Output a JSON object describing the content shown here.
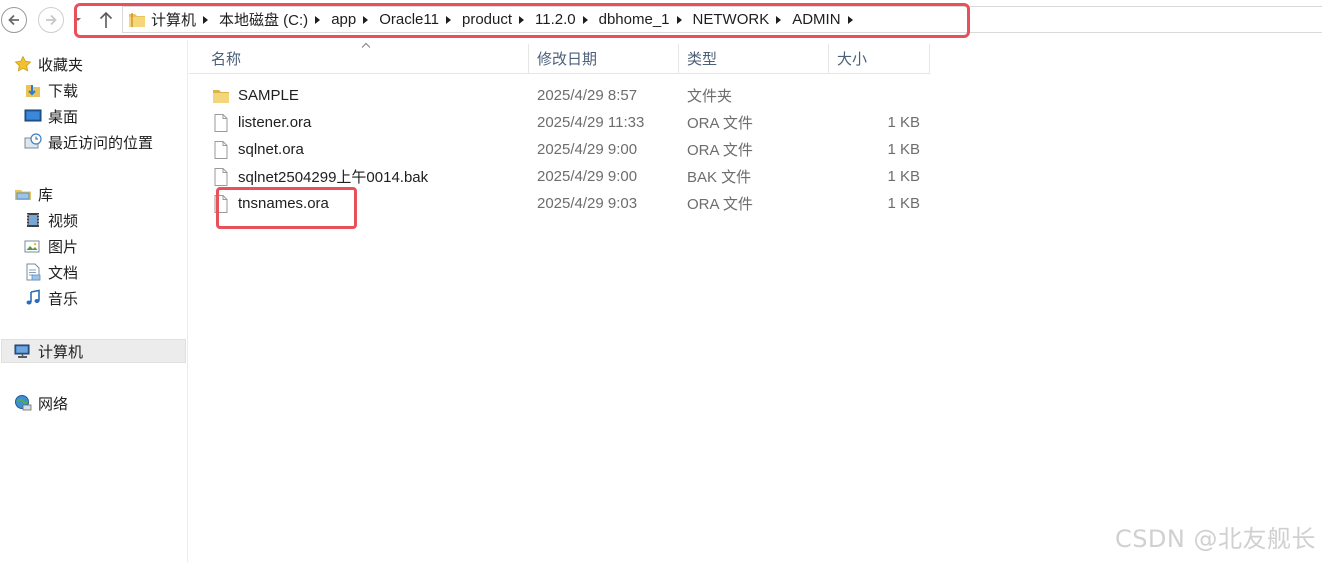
{
  "address_bar": {
    "breadcrumbs": [
      "计算机",
      "本地磁盘 (C:)",
      "app",
      "Oracle11",
      "product",
      "11.2.0",
      "dbhome_1",
      "NETWORK",
      "ADMIN"
    ]
  },
  "sidebar": {
    "favorites": {
      "label": "收藏夹",
      "items": [
        {
          "label": "下载",
          "icon": "download-folder-icon"
        },
        {
          "label": "桌面",
          "icon": "desktop-icon"
        },
        {
          "label": "最近访问的位置",
          "icon": "recent-places-icon"
        }
      ]
    },
    "libraries": {
      "label": "库",
      "items": [
        {
          "label": "视频",
          "icon": "video-library-icon"
        },
        {
          "label": "图片",
          "icon": "picture-library-icon"
        },
        {
          "label": "文档",
          "icon": "document-library-icon"
        },
        {
          "label": "音乐",
          "icon": "music-library-icon"
        }
      ]
    },
    "computer": {
      "label": "计算机"
    },
    "network": {
      "label": "网络"
    }
  },
  "file_list": {
    "columns": {
      "name": "名称",
      "date": "修改日期",
      "type": "类型",
      "size": "大小"
    },
    "rows": [
      {
        "name": "SAMPLE",
        "date": "2025/4/29 8:57",
        "type": "文件夹",
        "size": ""
      },
      {
        "name": "listener.ora",
        "date": "2025/4/29 11:33",
        "type": "ORA 文件",
        "size": "1 KB"
      },
      {
        "name": "sqlnet.ora",
        "date": "2025/4/29 9:00",
        "type": "ORA 文件",
        "size": "1 KB"
      },
      {
        "name": "sqlnet2504299上午0014.bak",
        "date": "2025/4/29 9:00",
        "type": "BAK 文件",
        "size": "1 KB"
      },
      {
        "name": "tnsnames.ora",
        "date": "2025/4/29 9:03",
        "type": "ORA 文件",
        "size": "1 KB"
      }
    ]
  },
  "watermark": "CSDN @北友舰长",
  "colors": {
    "highlight": "#e8505b",
    "header_text": "#4c607a"
  }
}
